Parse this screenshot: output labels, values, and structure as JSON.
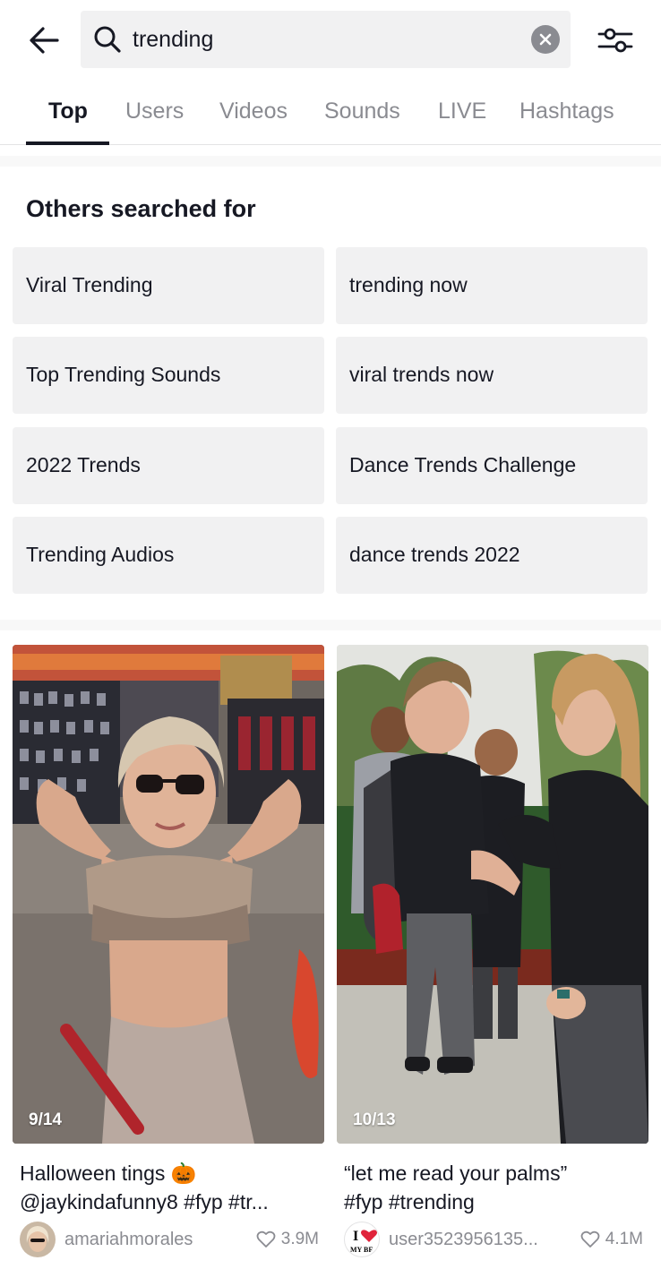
{
  "search": {
    "query": "trending"
  },
  "tabs": [
    {
      "label": "Top"
    },
    {
      "label": "Users"
    },
    {
      "label": "Videos"
    },
    {
      "label": "Sounds"
    },
    {
      "label": "LIVE"
    },
    {
      "label": "Hashtags"
    }
  ],
  "others_searched": {
    "title": "Others searched for",
    "items": [
      {
        "label": "Viral Trending"
      },
      {
        "label": "trending now"
      },
      {
        "label": "Top Trending Sounds"
      },
      {
        "label": "viral trends now"
      },
      {
        "label": "2022 Trends"
      },
      {
        "label": "Dance Trends Challenge"
      },
      {
        "label": "Trending Audios"
      },
      {
        "label": "dance trends 2022"
      }
    ]
  },
  "videos": [
    {
      "counter": "9/14",
      "caption_line1": "Halloween tings 🎃",
      "caption_line2": "@jaykindafunny8 #fyp #tr...",
      "username": "amariahmorales",
      "likes": "3.9M"
    },
    {
      "counter": "10/13",
      "caption_line1": "“let me read your palms”",
      "caption_line2": "#fyp #trending",
      "username": "user3523956135...",
      "likes": "4.1M",
      "avatar_text_top": "I",
      "avatar_text_bottom": "MY BF"
    }
  ],
  "colors": {
    "text_primary": "#161823",
    "text_secondary": "#8a8b91",
    "chip_bg": "#f1f1f2",
    "heart_red": "#e0233a"
  },
  "icons": {
    "back": "arrow-left-icon",
    "search": "search-icon",
    "clear": "close-circle-icon",
    "filter": "sliders-icon",
    "like": "heart-outline-icon"
  }
}
